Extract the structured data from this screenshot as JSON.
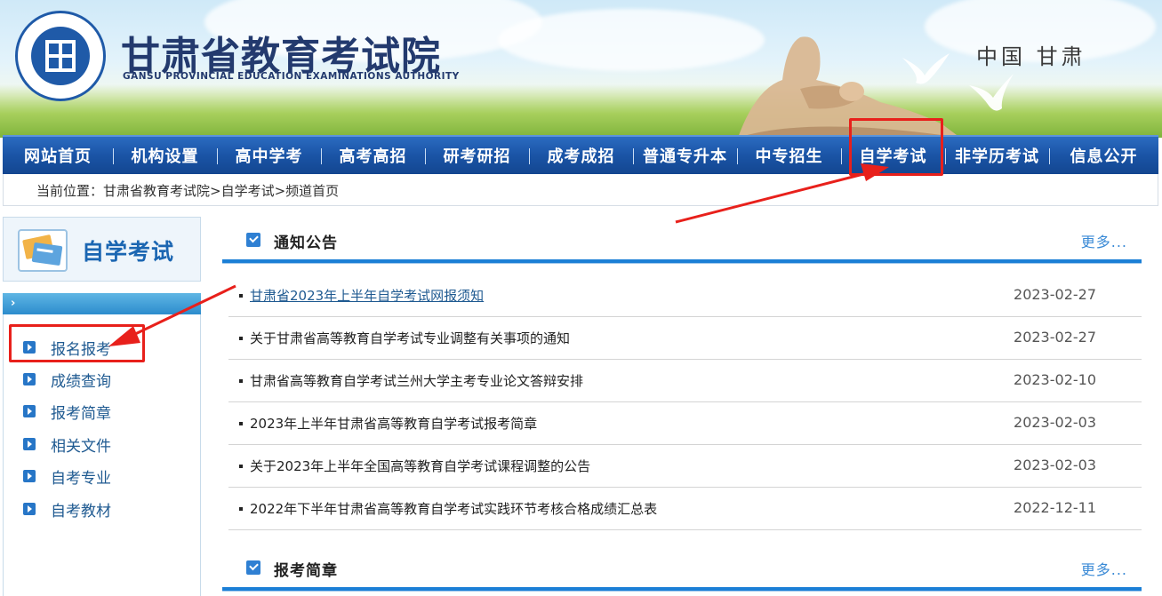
{
  "header": {
    "site_title": "甘肃省教育考试院",
    "site_subtitle": "GANSU PROVINCIAL EDUCATION EXAMINATIONS AUTHORITY",
    "region": "中国 甘肃",
    "logo_icon": "emblem-icon"
  },
  "nav": {
    "items": [
      {
        "label": "网站首页"
      },
      {
        "label": "机构设置"
      },
      {
        "label": "高中学考"
      },
      {
        "label": "高考高招"
      },
      {
        "label": "研考研招"
      },
      {
        "label": "成考成招"
      },
      {
        "label": "普通专升本"
      },
      {
        "label": "中专招生"
      },
      {
        "label": "自学考试"
      },
      {
        "label": "非学历考试"
      },
      {
        "label": "信息公开"
      }
    ]
  },
  "breadcrumb": {
    "text": "当前位置：甘肃省教育考试院>自学考试>频道首页"
  },
  "sidebar": {
    "title": "自学考试",
    "items": [
      {
        "label": "报名报考"
      },
      {
        "label": "成绩查询"
      },
      {
        "label": "报考简章"
      },
      {
        "label": "相关文件"
      },
      {
        "label": "自考专业"
      },
      {
        "label": "自考教材"
      }
    ]
  },
  "notices": {
    "title": "通知公告",
    "more": "更多...",
    "items": [
      {
        "title": "甘肃省2023年上半年自学考试网报须知",
        "date": "2023-02-27"
      },
      {
        "title": "关于甘肃省高等教育自学考试专业调整有关事项的通知",
        "date": "2023-02-27"
      },
      {
        "title": "甘肃省高等教育自学考试兰州大学主考专业论文答辩安排",
        "date": "2023-02-10"
      },
      {
        "title": "2023年上半年甘肃省高等教育自学考试报考简章",
        "date": "2023-02-03"
      },
      {
        "title": "关于2023年上半年全国高等教育自学考试课程调整的公告",
        "date": "2023-02-03"
      },
      {
        "title": "2022年下半年甘肃省高等教育自学考试实践环节考核合格成绩汇总表",
        "date": "2022-12-11"
      }
    ]
  },
  "guide": {
    "title": "报考简章",
    "more": "更多..."
  },
  "colors": {
    "nav_blue": "#1a54a6",
    "link_blue": "#1f5a91",
    "accent_blue": "#1b7fd6",
    "annotation_red": "#e8201b"
  }
}
